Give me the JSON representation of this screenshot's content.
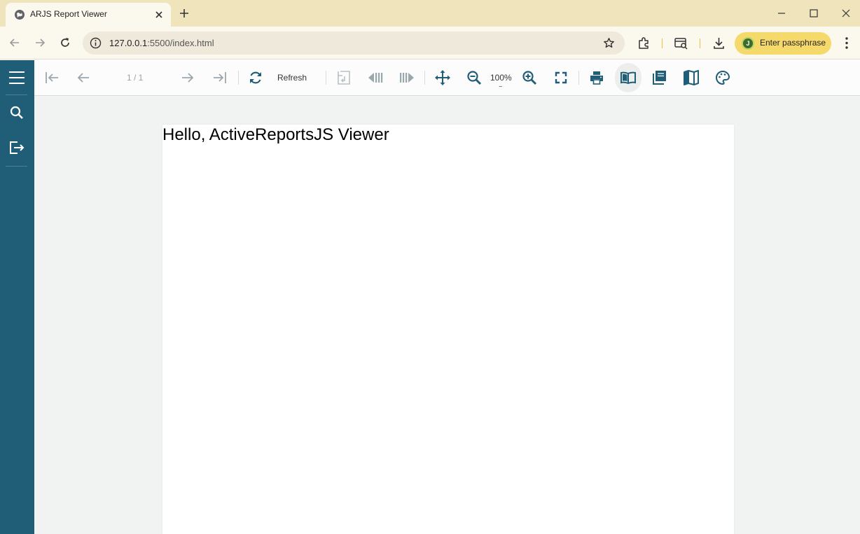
{
  "browser": {
    "tab_title": "ARJS Report Viewer",
    "url_host": "127.0.0.1",
    "url_rest": ":5500/index.html",
    "profile_initial": "J",
    "profile_label": "Enter passphrase",
    "colors": {
      "tabstrip": "#f0e4bd",
      "toolbar": "#fbf8ee",
      "profile": "#f6d96b"
    }
  },
  "viewer": {
    "page_indicator": "1 / 1",
    "refresh_label": "Refresh",
    "zoom_label": "100%",
    "zoom_dots": "...",
    "colors": {
      "sidebar": "#205e77",
      "icon": "#205e77",
      "disabled_icon": "#9aa8ae",
      "canvas": "#f1f2f2"
    },
    "sidebar_icons": [
      "menu-icon",
      "search-icon",
      "export-icon"
    ],
    "toolbar_icons": [
      "first-page-icon",
      "previous-page-icon",
      "next-page-icon",
      "last-page-icon",
      "refresh-icon",
      "back-to-parent-icon",
      "previous-section-icon",
      "next-section-icon",
      "pan-icon",
      "zoom-out-icon",
      "zoom-in-icon",
      "fullscreen-icon",
      "print-icon",
      "single-page-icon",
      "continuous-icon",
      "galley-icon",
      "theme-icon"
    ]
  },
  "report": {
    "content": "Hello, ActiveReportsJS Viewer"
  }
}
